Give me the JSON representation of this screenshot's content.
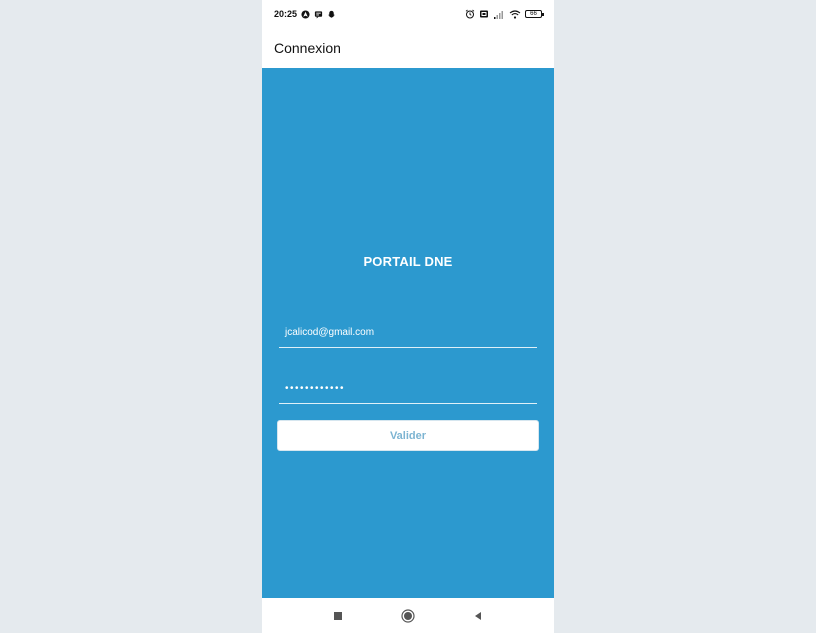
{
  "status_bar": {
    "time": "20:25",
    "battery": "66",
    "left_icons": [
      "android-auto-icon",
      "message-icon",
      "snapchat-icon"
    ],
    "right_icons": [
      "alarm-icon",
      "sim-icon",
      "signal-icon",
      "wifi-icon",
      "battery-icon"
    ]
  },
  "app_bar": {
    "title": "Connexion"
  },
  "login": {
    "heading": "PORTAIL DNE",
    "email_value": "jcalicod@gmail.com",
    "password_masked": "••••••••••••",
    "submit_label": "Valider"
  },
  "nav_bar": {
    "icons": [
      "recent-apps-icon",
      "home-icon",
      "back-icon"
    ]
  },
  "colors": {
    "primary": "#2c99cf",
    "button_text": "#7cb4d2",
    "background": "#e5eaee"
  }
}
